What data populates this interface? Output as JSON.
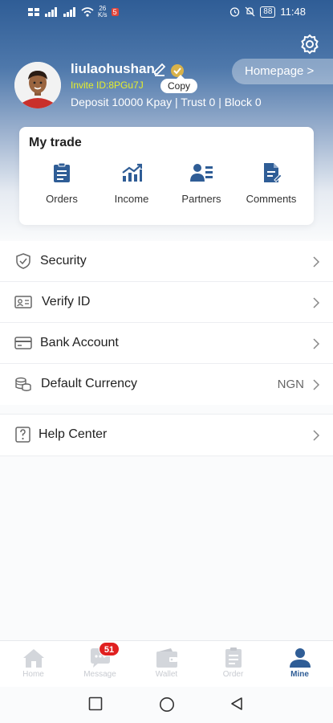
{
  "status_bar": {
    "speed_value": "26",
    "speed_unit": "K/s",
    "battery": "88",
    "time": "11:48",
    "app_badge": "5"
  },
  "profile": {
    "username": "liulaohushan",
    "invite_id": "Invite ID:8PGu7J",
    "copy_label": "Copy",
    "stats": "Deposit 10000 Kpay | Trust 0 | Block 0",
    "homepage_label": "Homepage >"
  },
  "trade": {
    "title": "My trade",
    "items": [
      {
        "label": "Orders",
        "icon": "orders-icon"
      },
      {
        "label": "Income",
        "icon": "income-icon"
      },
      {
        "label": "Partners",
        "icon": "partners-icon"
      },
      {
        "label": "Comments",
        "icon": "comments-icon"
      }
    ]
  },
  "menu": {
    "security": "Security",
    "verify_id": "Verify ID",
    "bank_account": "Bank Account",
    "default_currency": "Default Currency",
    "currency_value": "NGN",
    "help_center": "Help Center"
  },
  "tabs": [
    {
      "label": "Home",
      "icon": "home-icon"
    },
    {
      "label": "Message",
      "icon": "message-icon",
      "badge": "51"
    },
    {
      "label": "Wallet",
      "icon": "wallet-icon"
    },
    {
      "label": "Order",
      "icon": "order-icon"
    },
    {
      "label": "Mine",
      "icon": "person-icon",
      "active": true
    }
  ],
  "colors": {
    "accent": "#2f5d96",
    "invite": "#e6ef2a",
    "badge": "#e02020",
    "inactive_tab": "#c8cbd1"
  }
}
